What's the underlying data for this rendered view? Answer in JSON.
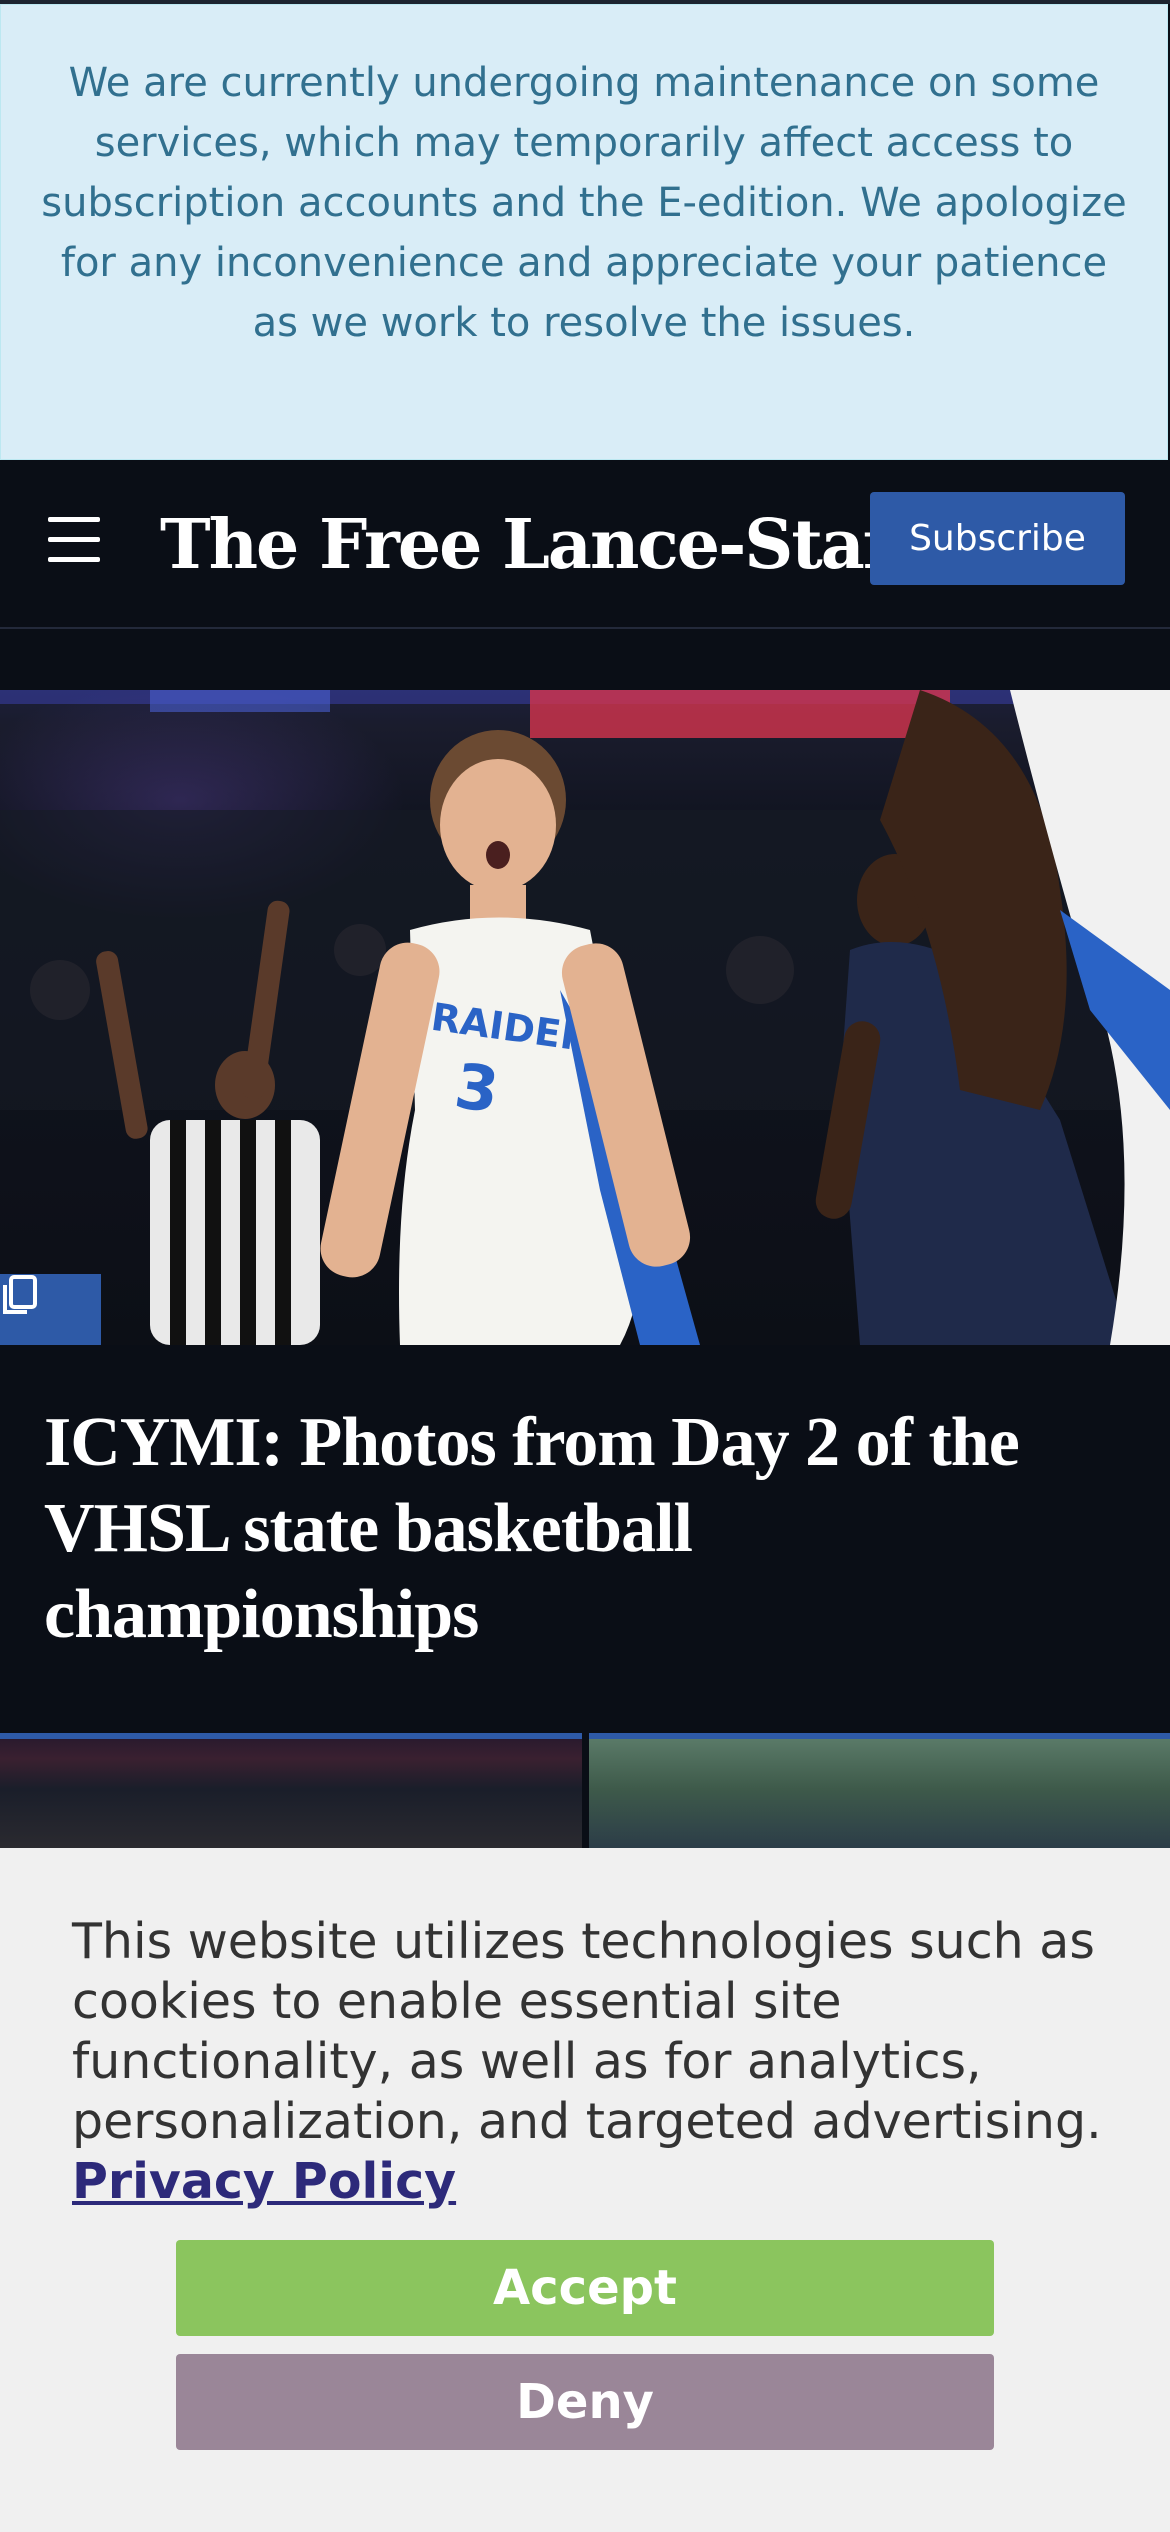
{
  "notice": {
    "message": "We are currently undergoing maintenance on some services, which may temporarily affect access to subscription accounts and the E-edition. We apologize for any inconvenience and appreciate your patience as we work to resolve the issues."
  },
  "header": {
    "logo": "The Free Lance-Star",
    "subscribe_label": "Subscribe",
    "menu_icon": "hamburger-menu-icon"
  },
  "hero": {
    "image_alt": "Basketball player in a white Raiders #3 jersey celebrating on court",
    "jersey_text": "RAIDERS",
    "gallery_icon": "gallery-icon"
  },
  "article": {
    "headline": "ICYMI: Photos from Day 2 of the VHSL state basketball championships"
  },
  "cookie_banner": {
    "message": "This website utilizes technologies such as cookies to enable essential site functionality, as well as for analytics, personalization, and targeted advertising. ",
    "policy_link": "Privacy Policy",
    "accept_label": "Accept",
    "deny_label": "Deny"
  },
  "colors": {
    "page_bg": "#0a0e16",
    "accent_blue": "#2e5aa7",
    "notice_bg": "#d9edf7",
    "notice_text": "#31708f",
    "accept_green": "#8bc55e",
    "deny_mauve": "#9a8698"
  }
}
